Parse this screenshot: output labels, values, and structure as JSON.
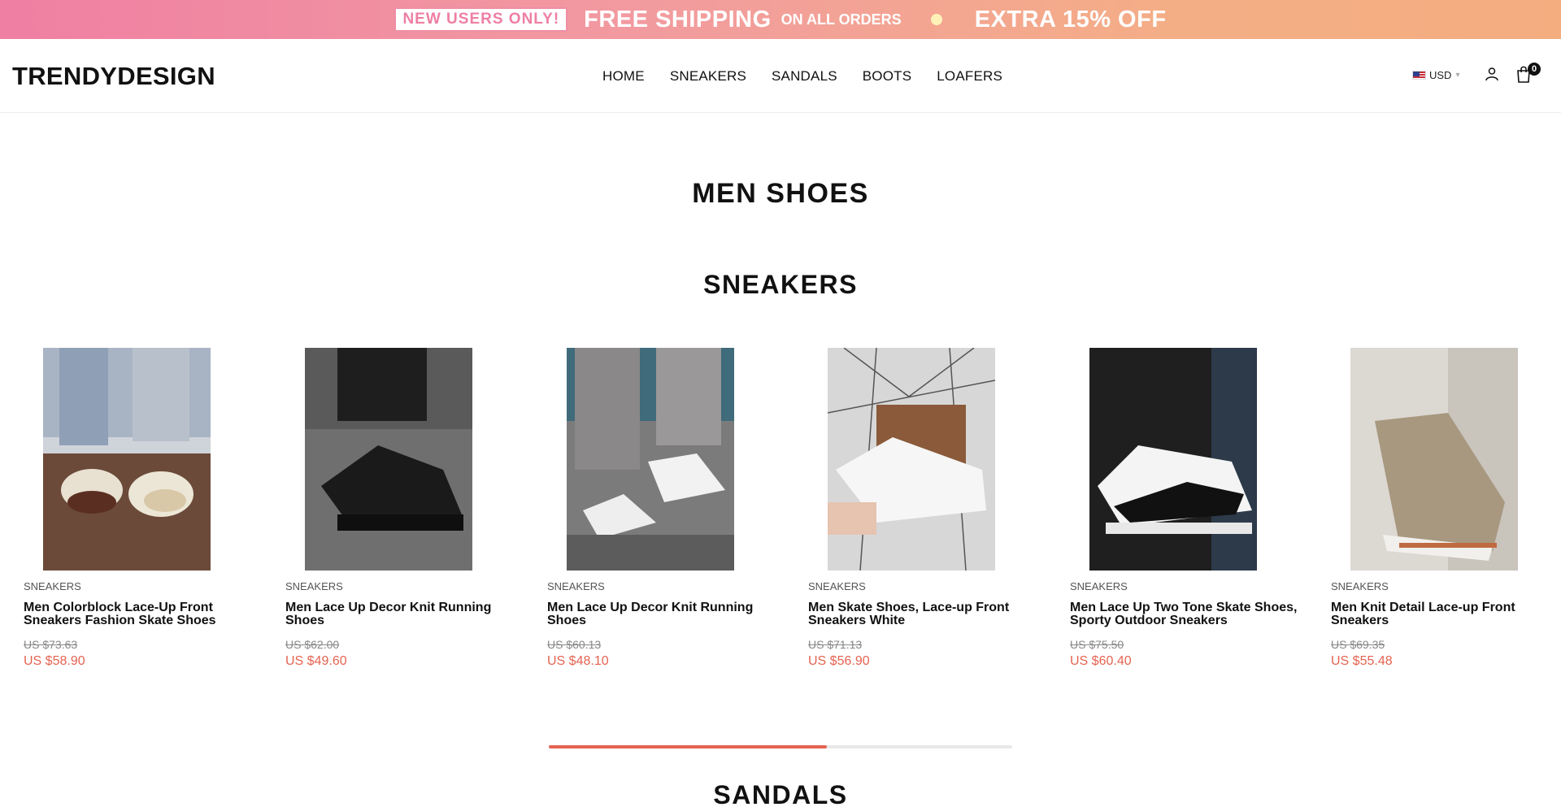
{
  "promo": {
    "new_users": "NEW USERS ONLY!",
    "free_shipping": "FREE SHIPPING",
    "all_orders": "ON ALL ORDERS",
    "extra_off": "EXTRA 15% OFF"
  },
  "header": {
    "logo": "TRENDYDESIGN",
    "nav": [
      "HOME",
      "SNEAKERS",
      "SANDALS",
      "BOOTS",
      "LOAFERS"
    ],
    "currency": "USD",
    "cart_count": "0",
    "icons": [
      "us-flag-icon",
      "chevron-down-icon",
      "user-icon",
      "cart-icon"
    ]
  },
  "main": {
    "page_title": "MEN SHOES",
    "sections": [
      "SNEAKERS",
      "SANDALS"
    ],
    "products": [
      {
        "category": "SNEAKERS",
        "name": "Men Colorblock Lace-Up Front Sneakers Fashion Skate Shoes",
        "old_price": "US $73.63",
        "price": "US $58.90"
      },
      {
        "category": "SNEAKERS",
        "name": "Men Lace Up Decor Knit Running Shoes",
        "old_price": "US $62.00",
        "price": "US $49.60"
      },
      {
        "category": "SNEAKERS",
        "name": "Men Lace Up Decor Knit Running Shoes",
        "old_price": "US $60.13",
        "price": "US $48.10"
      },
      {
        "category": "SNEAKERS",
        "name": "Men Skate Shoes, Lace-up Front Sneakers White",
        "old_price": "US $71.13",
        "price": "US $56.90"
      },
      {
        "category": "SNEAKERS",
        "name": "Men Lace Up Two Tone Skate Shoes, Sporty Outdoor Sneakers",
        "old_price": "US $75.50",
        "price": "US $60.40"
      },
      {
        "category": "SNEAKERS",
        "name": "Men Knit Detail Lace-up Front Sneakers",
        "old_price": "US $69.35",
        "price": "US $55.48"
      }
    ],
    "carousel_progress": 0.6
  },
  "colors": {
    "accent": "#e56351",
    "banner_start": "#ef7fa3",
    "banner_end": "#f3ad7f"
  }
}
